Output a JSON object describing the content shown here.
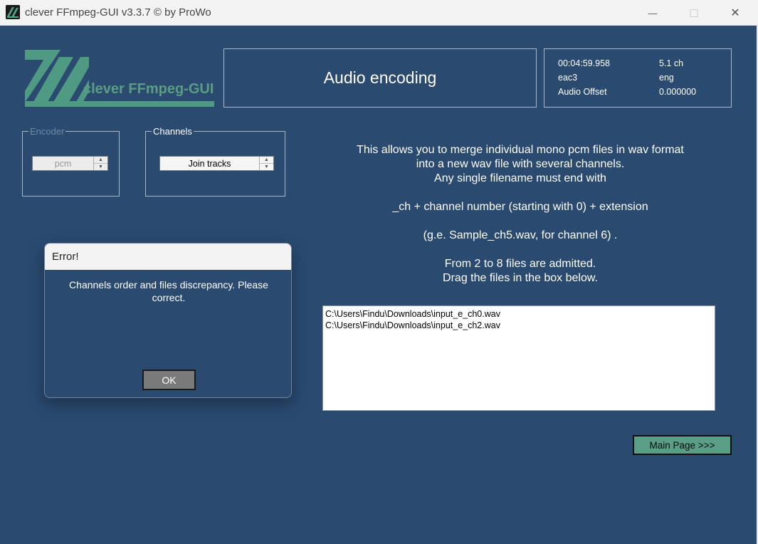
{
  "window": {
    "title": "clever FFmpeg-GUI v3.3.7   © by ProWo",
    "minimize_glyph": "—",
    "maximize_glyph": "□",
    "close_glyph": "✕"
  },
  "logo": {
    "text": "clever FFmpeg-GUI"
  },
  "header": {
    "title": "Audio encoding"
  },
  "info": {
    "duration": "00:04:59.958",
    "channels": "5.1 ch",
    "codec": "eac3",
    "language": "eng",
    "offset_label": "Audio Offset",
    "offset_value": "0.000000"
  },
  "encoder": {
    "legend": "Encoder",
    "value": "pcm"
  },
  "channels": {
    "legend": "Channels",
    "value": "Join tracks"
  },
  "description": {
    "line1": "This allows you to merge individual mono pcm files in wav format",
    "line2": "into a new wav file with several channels.",
    "line3": "Any single filename must end with",
    "line4": "_ch + channel number (starting with 0) + extension",
    "line5": "(g.e. Sample_ch5.wav, for channel 6) .",
    "line6": "From 2 to 8 files are admitted.",
    "line7": "Drag the files in the box below."
  },
  "files": [
    "C:\\Users\\Findu\\Downloads\\input_e_ch0.wav",
    "C:\\Users\\Findu\\Downloads\\input_e_ch2.wav"
  ],
  "buttons": {
    "main_page": "Main Page >>>"
  },
  "dialog": {
    "title": "Error!",
    "message": "Channels order and files discrepancy. Please correct.",
    "ok": "OK"
  },
  "colors": {
    "background": "#2a4a70",
    "accent": "#5a9e88",
    "logo": "#5c9c86"
  }
}
